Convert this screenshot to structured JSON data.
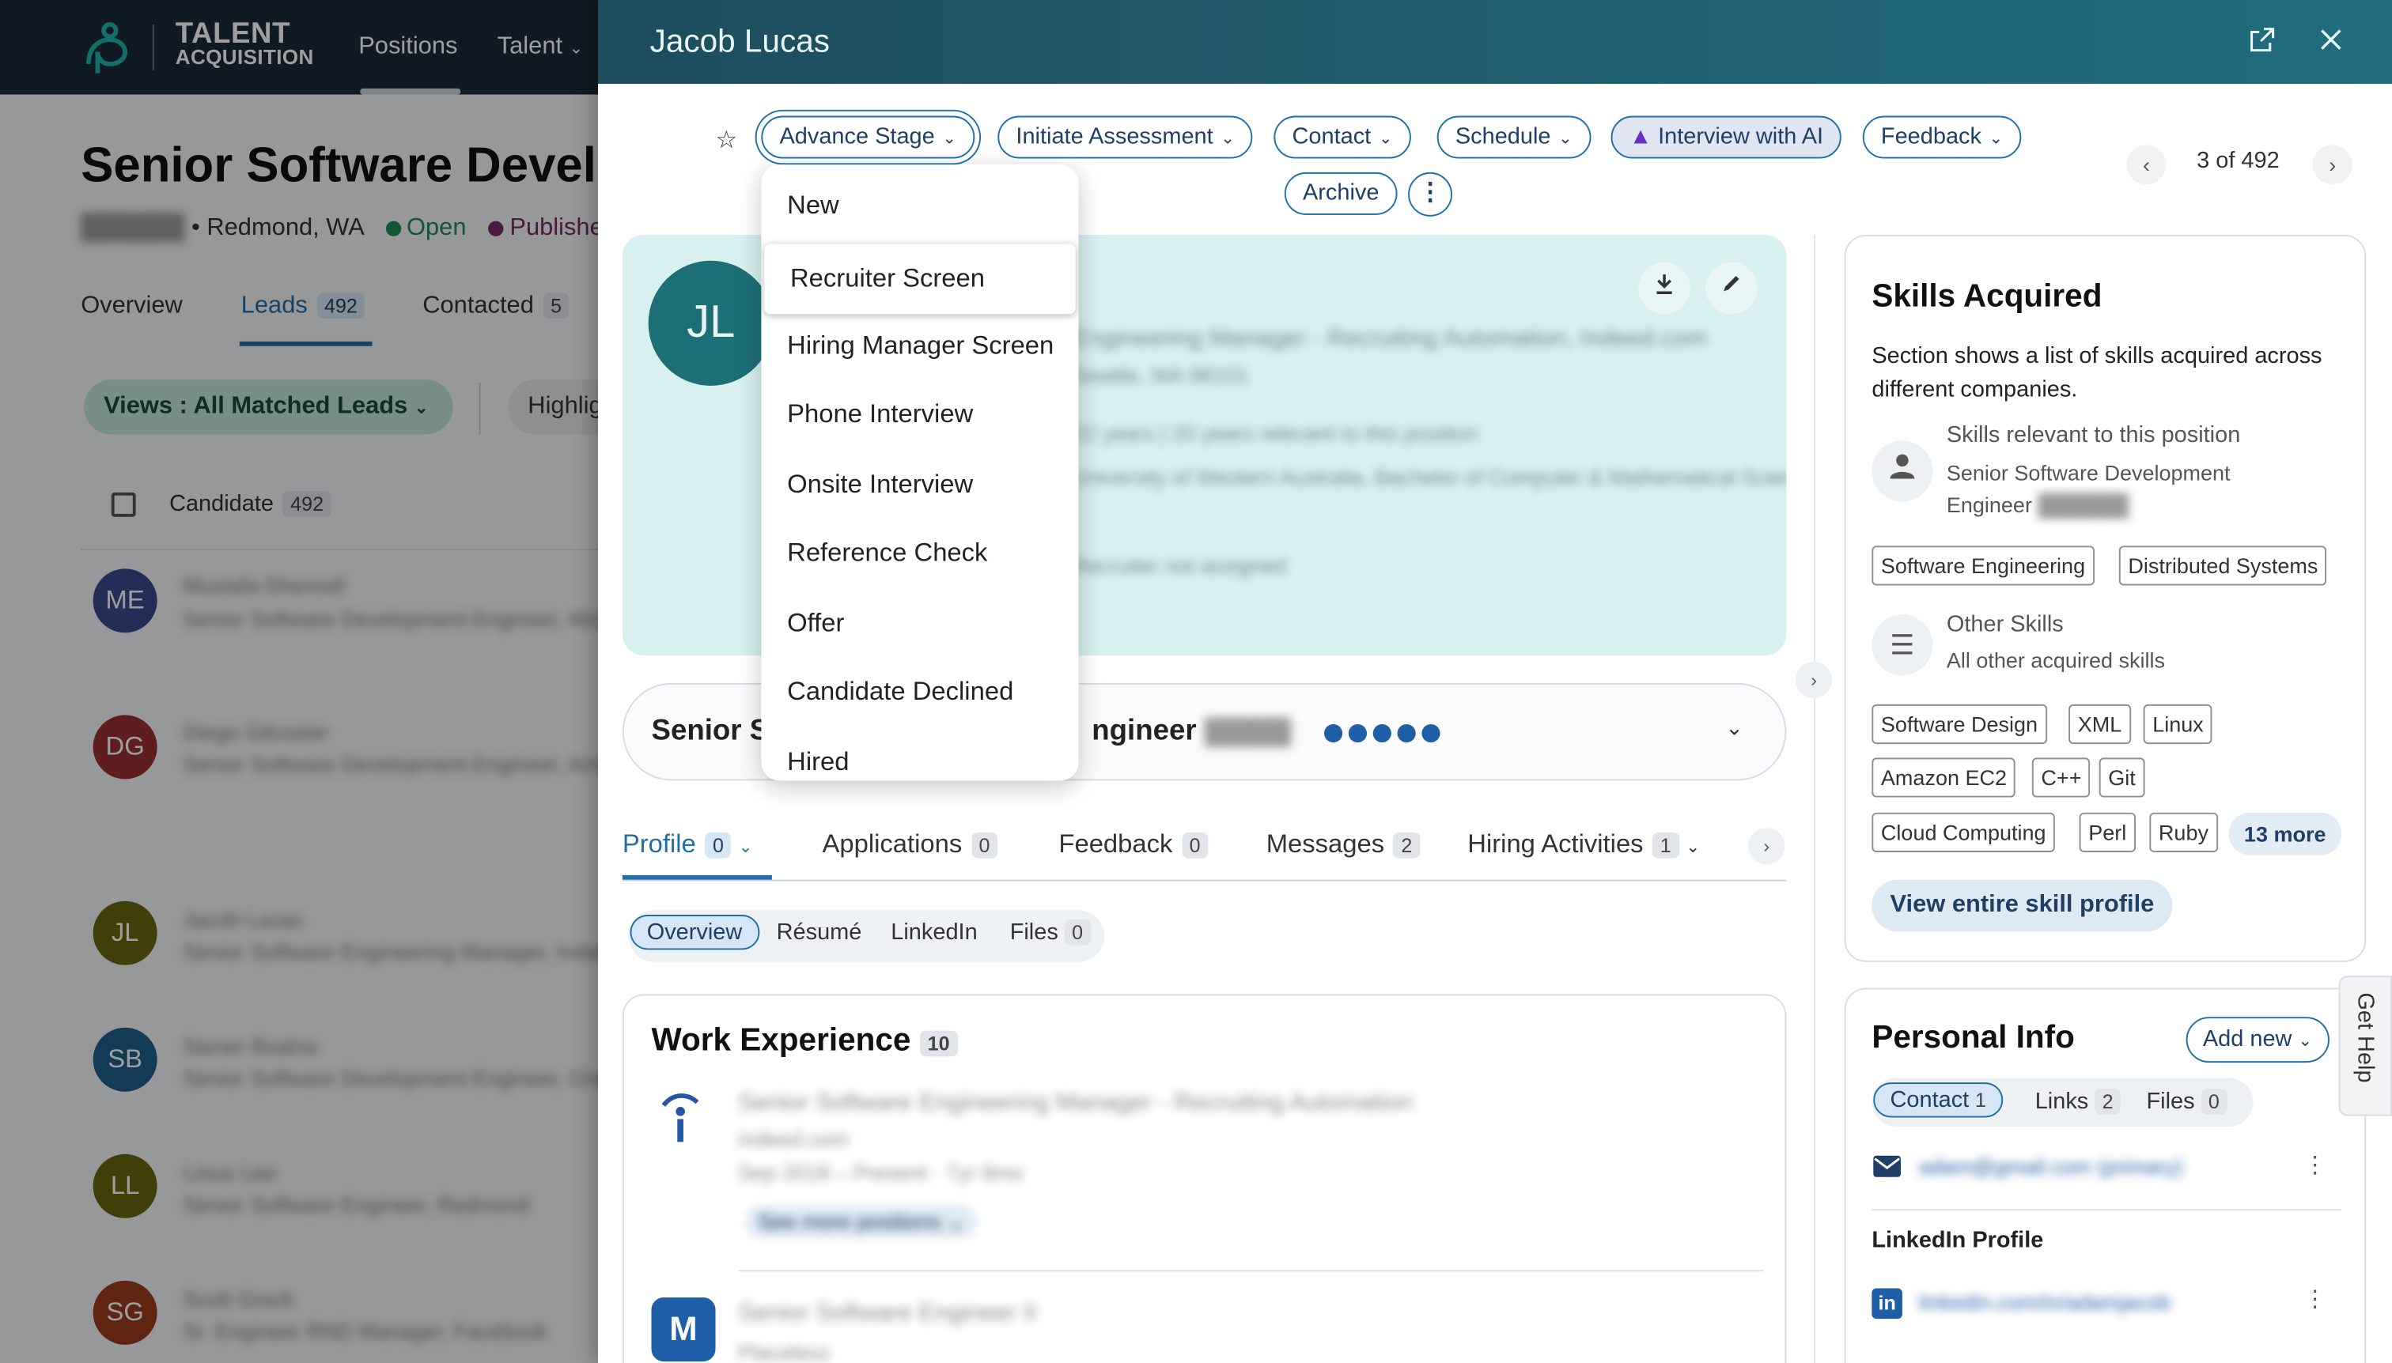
{
  "topbar": {
    "brand_line1": "TALENT",
    "brand_line2": "ACQUISITION",
    "nav": [
      "Positions",
      "Talent"
    ]
  },
  "background": {
    "job_title": "Senior Software Devel",
    "location": "Redmond, WA",
    "status_open": "Open",
    "status_published": "Publishe",
    "tabs": [
      {
        "label": "Overview",
        "count": ""
      },
      {
        "label": "Leads",
        "count": "492"
      },
      {
        "label": "Contacted",
        "count": "5"
      }
    ],
    "views_label": "Views : All Matched Leads",
    "highlights_label": "Highlig",
    "candidate_label": "Candidate",
    "candidate_count": "492",
    "leads": [
      {
        "initials": "ME",
        "color": "#3a4a8c"
      },
      {
        "initials": "DG",
        "color": "#9c2f2f"
      },
      {
        "initials": "JL",
        "color": "#6b6410"
      },
      {
        "initials": "SB",
        "color": "#1f5f8a"
      },
      {
        "initials": "LL",
        "color": "#6b6410"
      },
      {
        "initials": "SG",
        "color": "#9c3b1f"
      }
    ]
  },
  "panel": {
    "candidate_name": "Jacob Lucas",
    "actions": [
      {
        "label": "Advance Stage"
      },
      {
        "label": "Initiate Assessment"
      },
      {
        "label": "Contact"
      },
      {
        "label": "Schedule"
      },
      {
        "label": "Interview with AI"
      },
      {
        "label": "Feedback"
      }
    ],
    "archive_label": "Archive",
    "pager_text": "3 of 492",
    "avatar_initials": "JL",
    "job_box_title_left": "Senior So",
    "job_box_title_right": "ngineer",
    "profile_tabs": [
      {
        "label": "Profile",
        "count": "0"
      },
      {
        "label": "Applications",
        "count": "0"
      },
      {
        "label": "Feedback",
        "count": "0"
      },
      {
        "label": "Messages",
        "count": "2"
      },
      {
        "label": "Hiring Activities",
        "count": "1"
      }
    ],
    "sub_tabs": [
      {
        "label": "Overview"
      },
      {
        "label": "Résumé"
      },
      {
        "label": "LinkedIn"
      },
      {
        "label": "Files",
        "count": "0"
      }
    ],
    "work_experience_title": "Work Experience",
    "work_experience_count": "10"
  },
  "stage_dropdown": {
    "items": [
      "New",
      "Recruiter Screen",
      "Hiring Manager Screen",
      "Phone Interview",
      "Onsite Interview",
      "Reference Check",
      "Offer",
      "Candidate Declined",
      "Hired"
    ],
    "highlighted": "Recruiter Screen"
  },
  "skills": {
    "title": "Skills Acquired",
    "description": "Section shows a list of skills acquired across different companies.",
    "relevant_title": "Skills relevant to this position",
    "relevant_subtitle": "Senior Software Development Engineer",
    "relevant_chips": [
      "Software Engineering",
      "Distributed Systems"
    ],
    "other_title": "Other Skills",
    "other_subtitle": "All other acquired skills",
    "other_chips": [
      "Software Design",
      "XML",
      "Linux",
      "Amazon EC2",
      "C++",
      "Git",
      "Cloud Computing",
      "Perl",
      "Ruby"
    ],
    "more_label": "13 more",
    "view_all_label": "View entire skill profile"
  },
  "personal_info": {
    "title": "Personal Info",
    "add_new_label": "Add new",
    "tabs": [
      {
        "label": "Contact",
        "count": "1"
      },
      {
        "label": "Links",
        "count": "2"
      },
      {
        "label": "Files",
        "count": "0"
      }
    ],
    "linkedin_label": "LinkedIn Profile"
  },
  "get_help_label": "Get Help",
  "colors": {
    "brand_dark": "#1b2a3a",
    "accent_blue": "#1f6fa8",
    "panel_header": "#1e4d5c",
    "open_status": "#1f8a55",
    "published_status": "#7a2a6a"
  }
}
